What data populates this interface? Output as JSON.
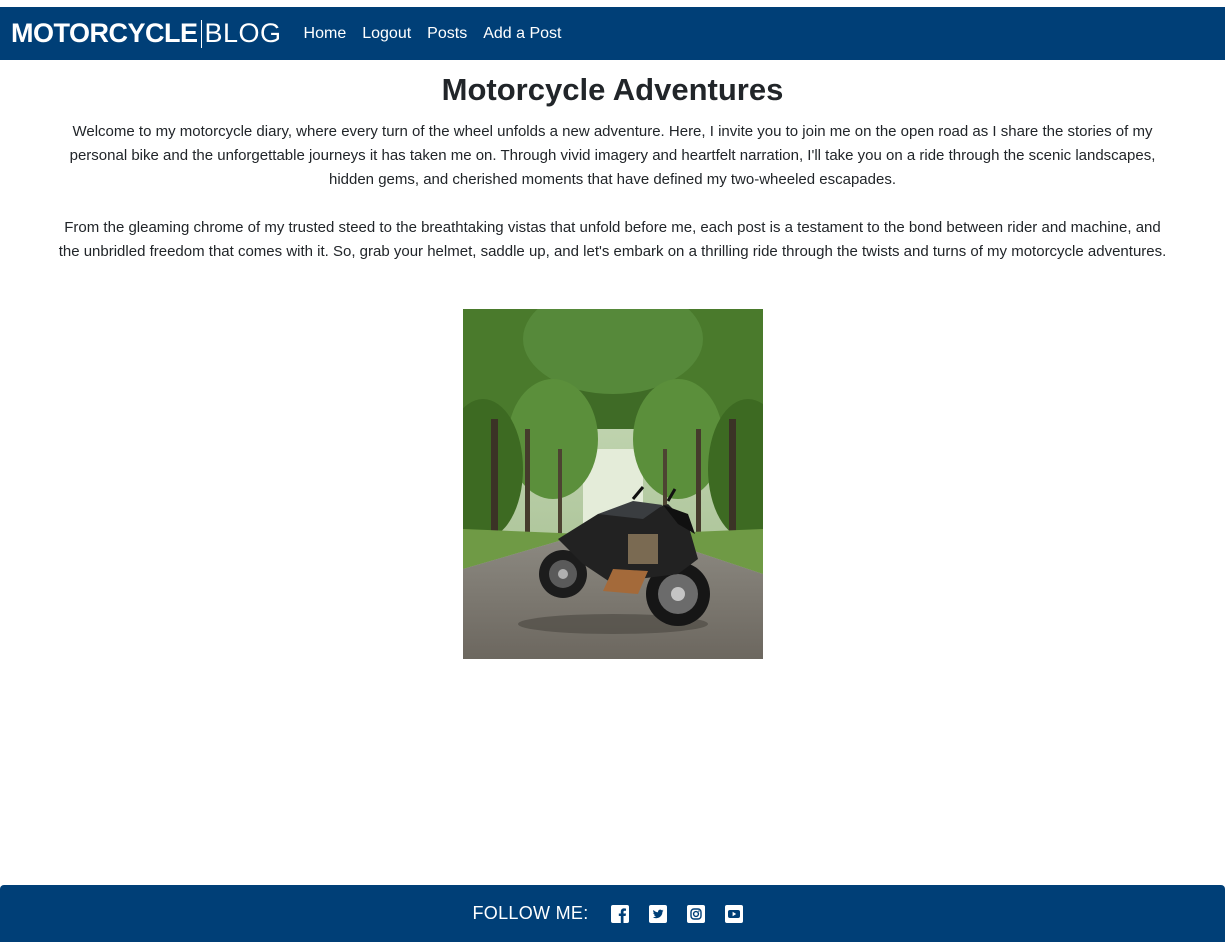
{
  "header": {
    "brand_strong": "MOTORCYCLE",
    "brand_light": "BLOG",
    "nav": [
      {
        "label": "Home"
      },
      {
        "label": "Logout"
      },
      {
        "label": "Posts"
      },
      {
        "label": "Add a Post"
      }
    ]
  },
  "main": {
    "title": "Motorcycle Adventures",
    "paragraphs": [
      "Welcome to my motorcycle diary, where every turn of the wheel unfolds a new adventure. Here, I invite you to join me on the open road as I share the stories of my personal bike and the unforgettable journeys it has taken me on. Through vivid imagery and heartfelt narration, I'll take you on a ride through the scenic landscapes, hidden gems, and cherished moments that have defined my two-wheeled escapades.",
      "From the gleaming chrome of my trusted steed to the breathtaking vistas that unfold before me, each post is a testament to the bond between rider and machine, and the unbridled freedom that comes with it. So, grab your helmet, saddle up, and let's embark on a thrilling ride through the twists and turns of my motorcycle adventures."
    ]
  },
  "footer": {
    "follow_label": "FOLLOW ME:",
    "social_icons": [
      "facebook-icon",
      "twitter-icon",
      "instagram-icon",
      "youtube-icon"
    ]
  },
  "colors": {
    "navbar": "#003f77",
    "text": "#212529",
    "background": "#ffffff"
  }
}
